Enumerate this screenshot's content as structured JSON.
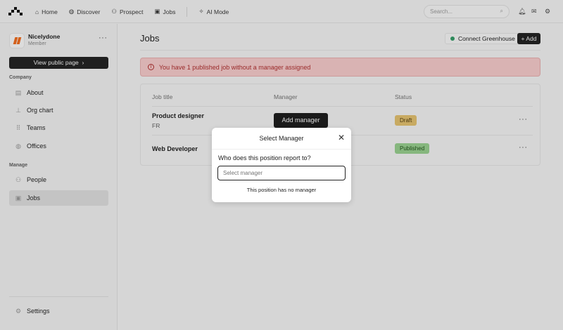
{
  "nav": {
    "items": [
      {
        "icon": "home-icon",
        "label": "Home"
      },
      {
        "icon": "globe-icon",
        "label": "Discover"
      },
      {
        "icon": "users-icon",
        "label": "Prospect"
      },
      {
        "icon": "briefcase-icon",
        "label": "Jobs"
      },
      {
        "icon": "sparkle-icon",
        "label": "AI Mode"
      }
    ],
    "search_placeholder": "Search..."
  },
  "sidebar": {
    "org_name": "Nicelydone",
    "org_role": "Member",
    "view_public": "View public page",
    "company_label": "Company",
    "company_items": [
      "About",
      "Org chart",
      "Teams",
      "Offices"
    ],
    "manage_label": "Manage",
    "manage_items": [
      "People",
      "Jobs"
    ],
    "settings": "Settings"
  },
  "main": {
    "title": "Jobs",
    "connect": "Connect Greenhouse",
    "add": "Add",
    "alert": "You have 1 published job without a manager assigned",
    "columns": [
      "Job title",
      "Manager",
      "Status"
    ],
    "jobs": [
      {
        "title": "Product designer",
        "location": "FR",
        "manager_action": "Add manager",
        "status": "Draft"
      },
      {
        "title": "Web Developer",
        "status": "Published"
      }
    ]
  },
  "modal": {
    "title": "Select Manager",
    "question": "Who does this position report to?",
    "placeholder": "Select manager",
    "no_manager": "This position has no manager"
  }
}
